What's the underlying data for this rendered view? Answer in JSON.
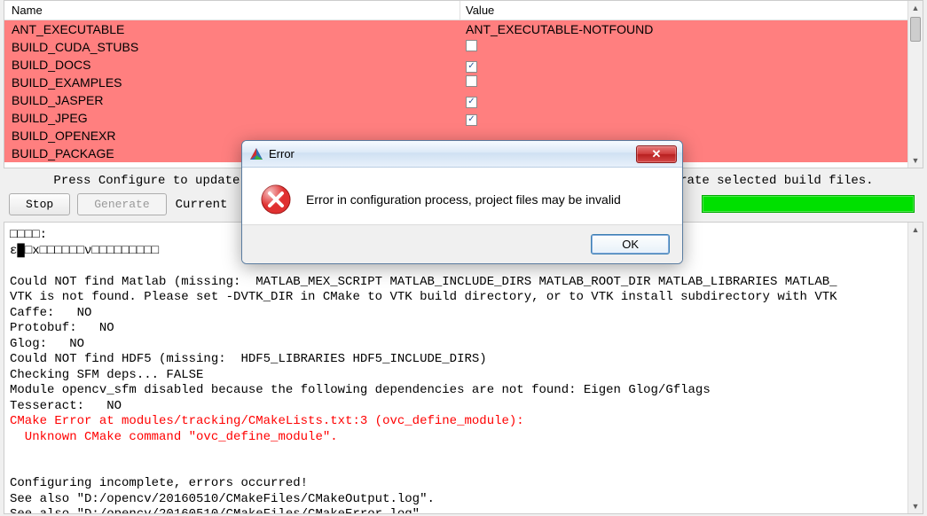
{
  "table": {
    "header": {
      "name": "Name",
      "value": "Value"
    },
    "rows": [
      {
        "name": "ANT_EXECUTABLE",
        "type": "text",
        "value": "ANT_EXECUTABLE-NOTFOUND"
      },
      {
        "name": "BUILD_CUDA_STUBS",
        "type": "check",
        "checked": false
      },
      {
        "name": "BUILD_DOCS",
        "type": "check",
        "checked": true
      },
      {
        "name": "BUILD_EXAMPLES",
        "type": "check",
        "checked": false
      },
      {
        "name": "BUILD_JASPER",
        "type": "check",
        "checked": true
      },
      {
        "name": "BUILD_JPEG",
        "type": "check",
        "checked": true
      },
      {
        "name": "BUILD_OPENEXR",
        "type": "check",
        "checked": null
      },
      {
        "name": "BUILD_PACKAGE",
        "type": "check",
        "checked": null
      }
    ]
  },
  "hint": "Press Configure to update and display new values in red, then press Generate to generate selected build files.",
  "buttons": {
    "stop": "Stop",
    "generate": "Generate",
    "current_label": "Current"
  },
  "dialog": {
    "title": "Error",
    "message": "Error in configuration process, project files may be invalid",
    "ok": "OK"
  },
  "log": {
    "l1": "□□□□:",
    "l2": "ε█□x□□□□□□ν□□□□□□□□□",
    "l3": "",
    "l4": "Could NOT find Matlab (missing:  MATLAB_MEX_SCRIPT MATLAB_INCLUDE_DIRS MATLAB_ROOT_DIR MATLAB_LIBRARIES MATLAB_",
    "l5": "VTK is not found. Please set -DVTK_DIR in CMake to VTK build directory, or to VTK install subdirectory with VTK",
    "l6": "Caffe:   NO",
    "l7": "Protobuf:   NO",
    "l8": "Glog:   NO",
    "l9": "Could NOT find HDF5 (missing:  HDF5_LIBRARIES HDF5_INCLUDE_DIRS)",
    "l10": "Checking SFM deps... FALSE",
    "l11": "Module opencv_sfm disabled because the following dependencies are not found: Eigen Glog/Gflags",
    "l12": "Tesseract:   NO",
    "l13": "CMake Error at modules/tracking/CMakeLists.txt:3 (ovc_define_module):",
    "l14": "  Unknown CMake command \"ovc_define_module\".",
    "l15": "",
    "l16": "",
    "l17": "Configuring incomplete, errors occurred!",
    "l18": "See also \"D:/opencv/20160510/CMakeFiles/CMakeOutput.log\".",
    "l19": "See also \"D:/opencv/20160510/CMakeFiles/CMakeError.log\"."
  }
}
